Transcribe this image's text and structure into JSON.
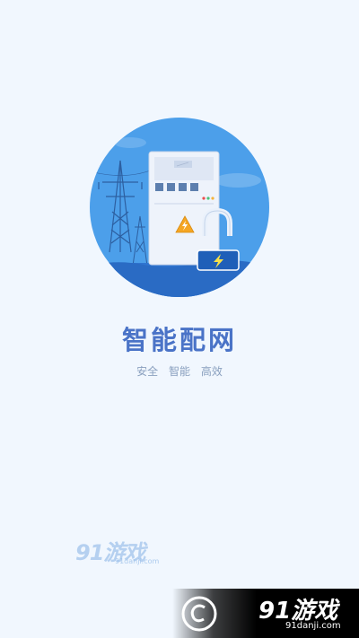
{
  "splash": {
    "title": "智能配网",
    "slogan": [
      "安全",
      "智能",
      "高效"
    ],
    "illustration_icon": "electrical-cabinet-illustration"
  },
  "watermark": {
    "small_main": "91游戏",
    "small_sub": "91danji.com",
    "banner_main": "91游戏",
    "banner_sub": "91danji.com"
  },
  "colors": {
    "background": "#f1f7fe",
    "accent": "#4a73c7",
    "circle": "#4a9ee8",
    "slogan": "#8aa0bf"
  }
}
